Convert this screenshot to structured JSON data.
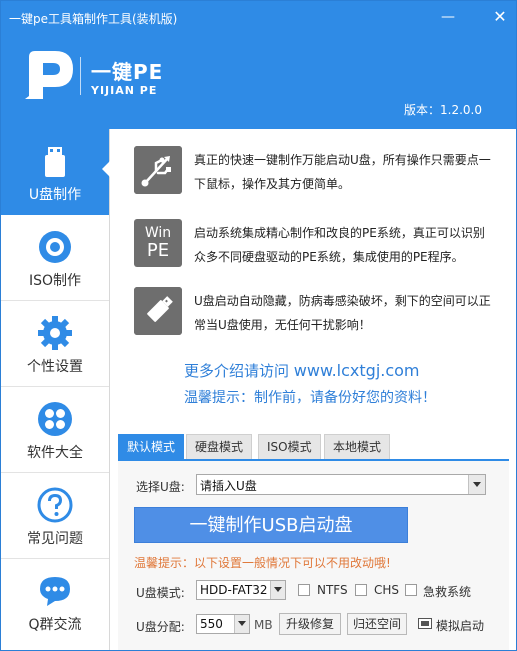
{
  "window": {
    "title": "一键pe工具箱制作工具(装机版)",
    "minimize_glyph": "—",
    "close_glyph": "✕"
  },
  "header": {
    "logo_name": "一键PE",
    "logo_sub": "YIJIAN PE",
    "version": "版本：1.2.0.0"
  },
  "sidebar": {
    "items": [
      {
        "label": "U盘制作",
        "icon": "usb-drive-icon",
        "active": true
      },
      {
        "label": "ISO制作",
        "icon": "disc-icon",
        "active": false
      },
      {
        "label": "个性设置",
        "icon": "gear-icon",
        "active": false
      },
      {
        "label": "软件大全",
        "icon": "apps-grid-icon",
        "active": false
      },
      {
        "label": "常见问题",
        "icon": "question-icon",
        "active": false
      },
      {
        "label": "Q群交流",
        "icon": "chat-icon",
        "active": false
      }
    ]
  },
  "features": [
    {
      "icon": "usb-symbol-icon",
      "text": "真正的快速一键制作万能启动U盘，所有操作只需要点一下鼠标，操作及其方便简单。"
    },
    {
      "icon": "win-pe-icon",
      "icon_text_1": "Win",
      "icon_text_2": "PE",
      "text": "启动系统集成精心制作和改良的PE系统，真正可以识别众多不同硬盘驱动的PE系统，集成使用的PE程序。"
    },
    {
      "icon": "usb-stick-icon",
      "text": "U盘启动自动隐藏，防病毒感染破坏，剩下的空间可以正常当U盘使用，无任何干扰影响！"
    }
  ],
  "promo": {
    "line1_prefix": "更多介绍请访问",
    "line1_url": "www.lcxtgj.com",
    "line2": "温馨提示：制作前，请备份好您的资料！"
  },
  "tabs": [
    {
      "label": "默认模式",
      "active": true
    },
    {
      "label": "硬盘模式",
      "active": false
    },
    {
      "label": "ISO模式",
      "active": false
    },
    {
      "label": "本地模式",
      "active": false
    }
  ],
  "form": {
    "select_udisk_label": "选择U盘:",
    "select_udisk_value": "请插入U盘",
    "make_button": "一键制作USB启动盘",
    "warning": "温馨提示：以下设置一般情况下可以不用改动哦!",
    "mode_label": "U盘模式:",
    "mode_value": "HDD-FAT32",
    "ntfs_label": "NTFS",
    "chs_label": "CHS",
    "rescue_label": "急救系统",
    "partition_label": "U盘分配:",
    "partition_value": "550",
    "partition_unit": "MB",
    "upgrade_button": "升级修复",
    "restore_button": "归还空间",
    "simulate_label": "模拟启动"
  },
  "colors": {
    "brand_blue": "#2f8be6",
    "button_blue": "#4f8fe6",
    "warning_orange": "#e0783a",
    "icon_gray": "#6e6e6e"
  }
}
